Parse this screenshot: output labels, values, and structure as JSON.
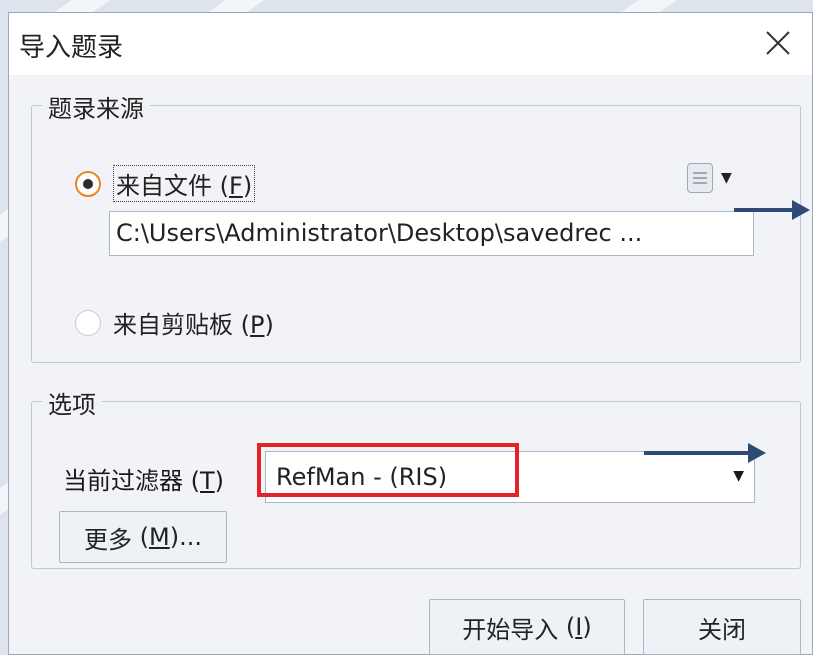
{
  "dialog": {
    "title": "导入题录"
  },
  "source_group": {
    "label": "题录来源",
    "from_file": {
      "label": "来自文件",
      "key": "F",
      "checked": true
    },
    "file_path": "C:\\Users\\Administrator\\Desktop\\savedrec ...",
    "from_clipboard": {
      "label": "来自剪贴板",
      "key": "P",
      "checked": false
    }
  },
  "options_group": {
    "label": "选项",
    "filter_label": "当前过滤器",
    "filter_key": "T",
    "filter_value": "RefMan - (RIS)",
    "more_button": {
      "label": "更多",
      "key": "M",
      "suffix": "..."
    }
  },
  "footer": {
    "start_import": {
      "label": "开始导入",
      "key": "I"
    },
    "close": {
      "label": "关闭"
    }
  },
  "colors": {
    "highlight": "#e5222a",
    "arrow": "#2d4b74",
    "radio_accent": "#f08020"
  },
  "icons": {
    "close": "close-icon",
    "file_menu": "document-icon",
    "dropdown": "chevron-down-icon"
  }
}
